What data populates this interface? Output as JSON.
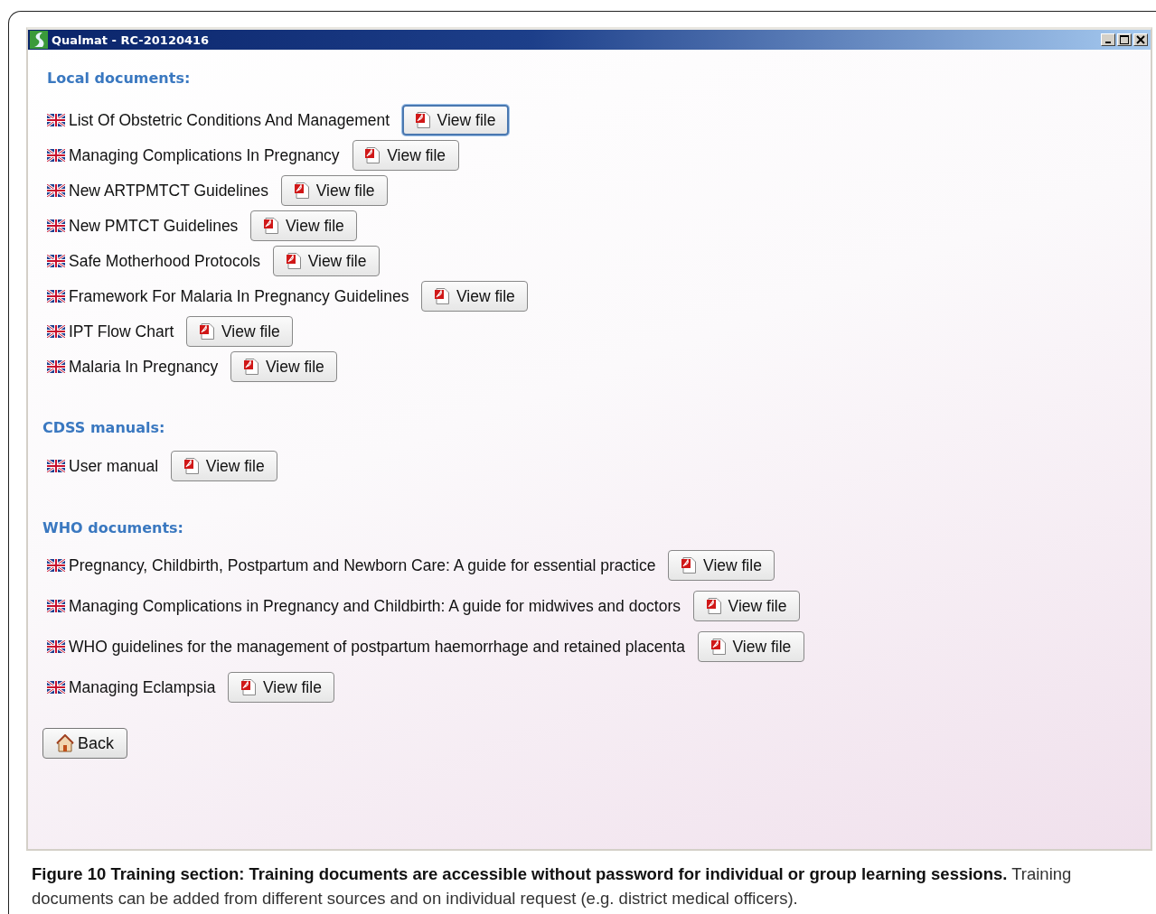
{
  "window": {
    "title": "Qualmat - RC-20120416"
  },
  "sections": [
    {
      "title": "Local documents:",
      "items": [
        {
          "label": "List Of Obstetric Conditions And Management",
          "button": "View file",
          "focused": true
        },
        {
          "label": "Managing Complications In Pregnancy",
          "button": "View file",
          "focused": false
        },
        {
          "label": "New ARTPMTCT Guidelines",
          "button": "View file",
          "focused": false
        },
        {
          "label": "New PMTCT Guidelines",
          "button": "View file",
          "focused": false
        },
        {
          "label": "Safe Motherhood Protocols",
          "button": "View file",
          "focused": false
        },
        {
          "label": "Framework For Malaria In Pregnancy Guidelines",
          "button": "View file",
          "focused": false
        },
        {
          "label": "IPT Flow Chart",
          "button": "View file",
          "focused": false
        },
        {
          "label": "Malaria In Pregnancy",
          "button": "View file",
          "focused": false
        }
      ]
    },
    {
      "title": "CDSS manuals:",
      "items": [
        {
          "label": "User manual",
          "button": "View file",
          "focused": false
        }
      ]
    },
    {
      "title": "WHO documents:",
      "items": [
        {
          "label": "Pregnancy, Childbirth, Postpartum and Newborn Care: A guide for essential practice",
          "button": "View file",
          "focused": false
        },
        {
          "label": "Managing Complications in Pregnancy and Childbirth: A guide for midwives and doctors",
          "button": "View file",
          "focused": false
        },
        {
          "label": "WHO guidelines for the management of postpartum haemorrhage and retained placenta",
          "button": "View file",
          "focused": false
        },
        {
          "label": "Managing Eclampsia",
          "button": "View file",
          "focused": false
        }
      ]
    }
  ],
  "back_button": "Back",
  "caption": "**Figure 10 Training section: Training documents are accessible without password for individual or group learning sessions.** Training documents can be added from different sources and on individual request (e.g. district medical officers)."
}
